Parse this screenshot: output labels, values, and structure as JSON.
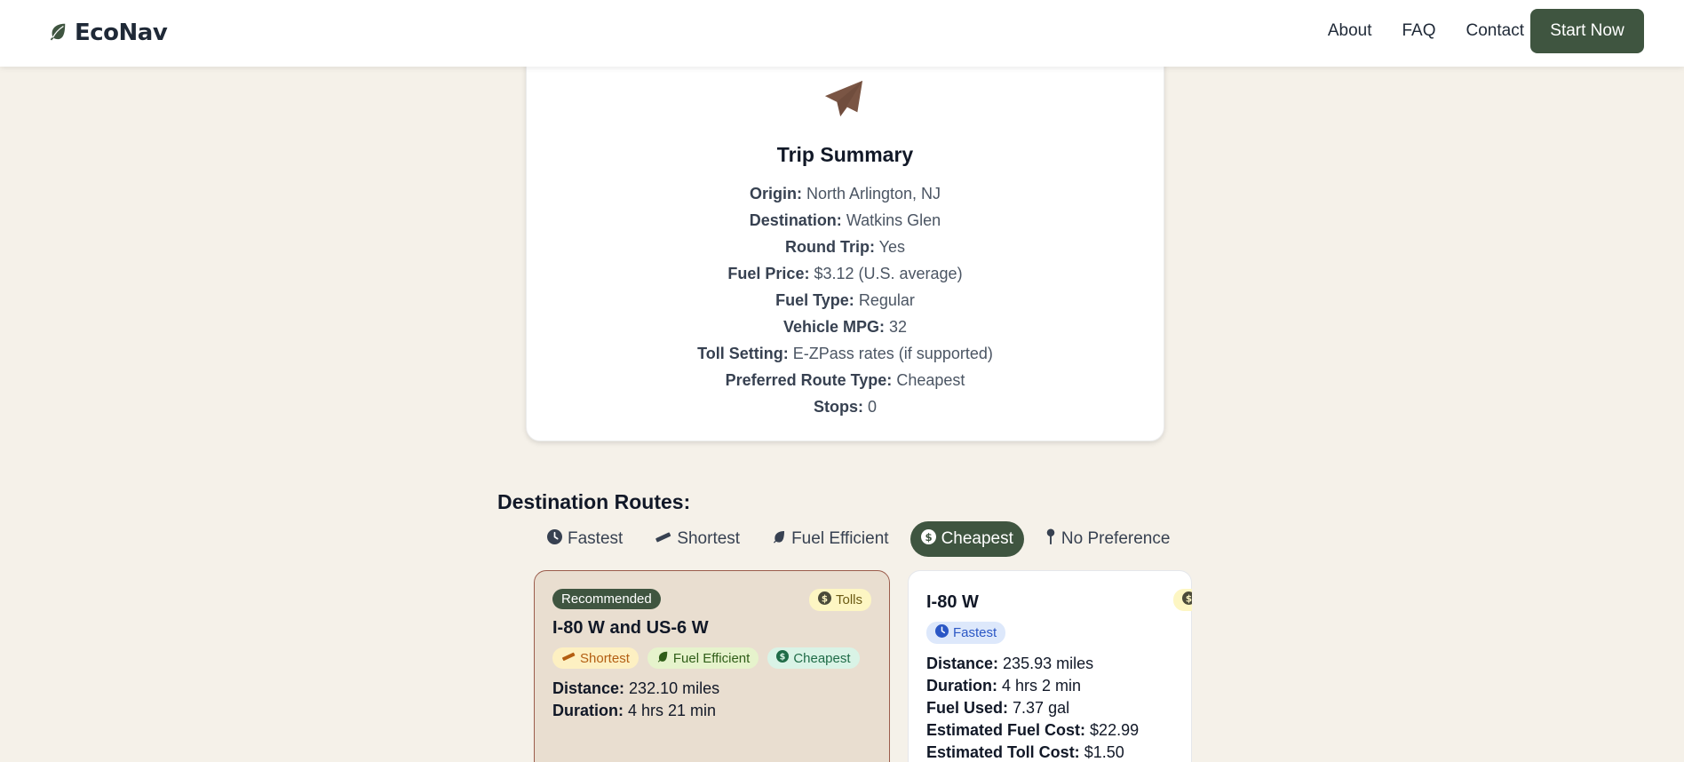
{
  "nav": {
    "brand": "EcoNav",
    "links": [
      "About",
      "FAQ",
      "Contact"
    ],
    "cta": "Start Now"
  },
  "summary": {
    "title": "Trip Summary",
    "rows": [
      {
        "label": "Origin:",
        "value": "North Arlington, NJ"
      },
      {
        "label": "Destination:",
        "value": "Watkins Glen"
      },
      {
        "label": "Round Trip:",
        "value": "Yes"
      },
      {
        "label": "Fuel Price:",
        "value": "$3.12 (U.S. average)"
      },
      {
        "label": "Fuel Type:",
        "value": "Regular"
      },
      {
        "label": "Vehicle MPG:",
        "value": "32"
      },
      {
        "label": "Toll Setting:",
        "value": "E-ZPass rates (if supported)"
      },
      {
        "label": "Preferred Route Type:",
        "value": "Cheapest"
      },
      {
        "label": "Stops:",
        "value": "0"
      }
    ]
  },
  "routes": {
    "heading": "Destination Routes:",
    "tabs": [
      {
        "label": "Fastest",
        "icon": "clock-icon"
      },
      {
        "label": "Shortest",
        "icon": "ruler-icon"
      },
      {
        "label": "Fuel Efficient",
        "icon": "leaf-icon"
      },
      {
        "label": "Cheapest",
        "icon": "dollar-icon"
      },
      {
        "label": "No Preference",
        "icon": "pin-icon"
      }
    ],
    "active_tab": "Cheapest",
    "cards": [
      {
        "badge": "Recommended",
        "tolls": "Tolls",
        "title": "I-80 W and US-6 W",
        "chips": [
          "Shortest",
          "Fuel Efficient",
          "Cheapest"
        ],
        "stats": [
          {
            "label": "Distance:",
            "value": "232.10 miles"
          },
          {
            "label": "Duration:",
            "value": "4 hrs 21 min"
          }
        ]
      },
      {
        "title": "I-80 W",
        "chips": [
          "Fastest"
        ],
        "stats": [
          {
            "label": "Distance:",
            "value": "235.93 miles"
          },
          {
            "label": "Duration:",
            "value": "4 hrs 2 min"
          },
          {
            "label": "Fuel Used:",
            "value": "7.37 gal"
          },
          {
            "label": "Estimated Fuel Cost:",
            "value": "$22.99"
          },
          {
            "label": "Estimated Toll Cost:",
            "value": "$1.50"
          }
        ]
      }
    ]
  },
  "colors": {
    "primary": "#3f5540",
    "background": "#f5f1e9",
    "plane": "#7a5544",
    "recommended_card": "#e9ded0"
  }
}
